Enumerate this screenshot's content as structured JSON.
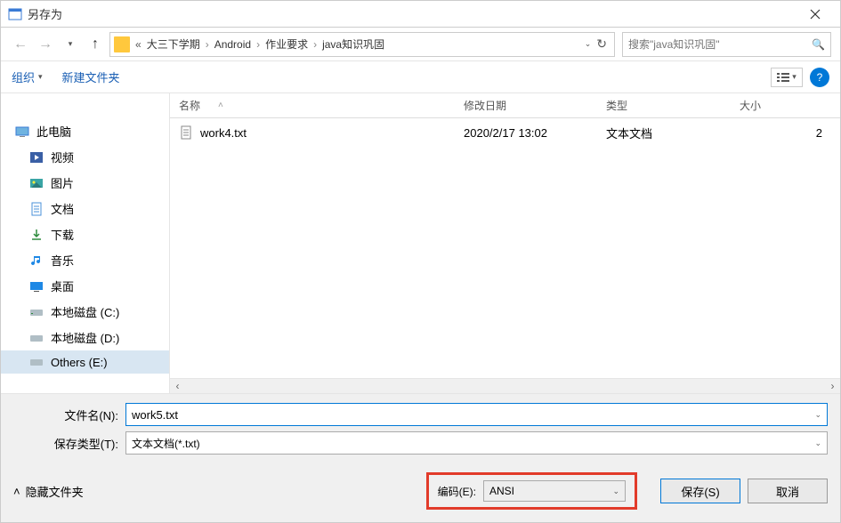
{
  "title": "另存为",
  "breadcrumbs": {
    "a": "大三下学期",
    "b": "Android",
    "c": "作业要求",
    "d": "java知识巩固"
  },
  "search": {
    "placeholder": "搜索\"java知识巩固\""
  },
  "toolbar": {
    "organize": "组织",
    "newfolder": "新建文件夹"
  },
  "sidebar": {
    "items": {
      "this_pc": "此电脑",
      "videos": "视频",
      "pictures": "图片",
      "documents": "文档",
      "downloads": "下载",
      "music": "音乐",
      "desktop": "桌面",
      "local_c": "本地磁盘 (C:)",
      "local_d": "本地磁盘 (D:)",
      "others_e": "Others (E:)"
    }
  },
  "columns": {
    "name": "名称",
    "date": "修改日期",
    "type": "类型",
    "size": "大小"
  },
  "file": {
    "name": "work4.txt",
    "date": "2020/2/17 13:02",
    "type": "文本文档",
    "size": "2"
  },
  "fields": {
    "filename_label": "文件名(N):",
    "filename_value": "work5.txt",
    "savetype_label": "保存类型(T):",
    "savetype_value": "文本文档(*.txt)"
  },
  "footer": {
    "hidefolders": "隐藏文件夹",
    "encoding_label": "编码(E):",
    "encoding_value": "ANSI",
    "save": "保存(S)",
    "cancel": "取消"
  }
}
